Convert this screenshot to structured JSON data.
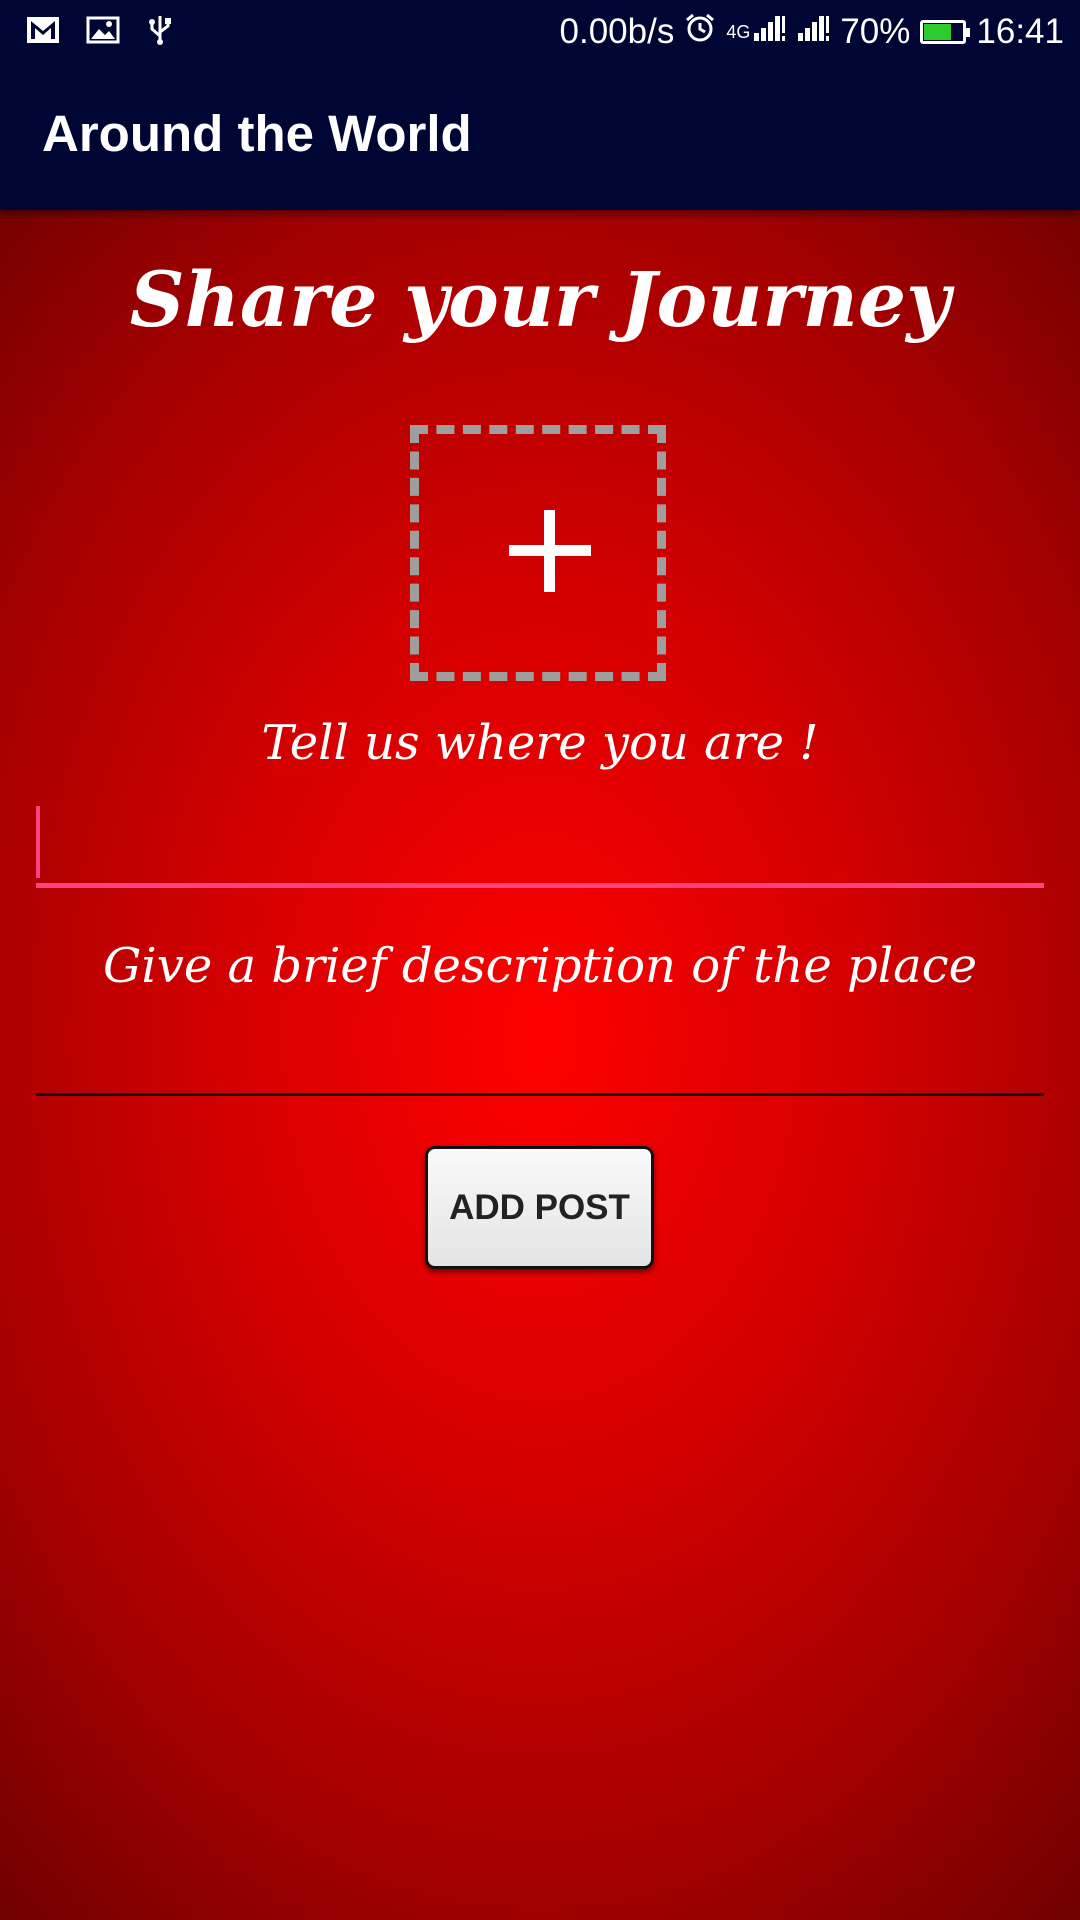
{
  "status_bar": {
    "network_speed": "0.00b/s",
    "network_type": "4G",
    "battery_percent": "70%",
    "battery_level": 0.7,
    "time": "16:41",
    "icons": [
      "gmail-icon",
      "image-icon",
      "usb-icon",
      "alarm-icon",
      "signal-icon",
      "signal-icon-2",
      "battery-icon"
    ]
  },
  "app_bar": {
    "title": "Around the World"
  },
  "form": {
    "heading": "Share your Journey",
    "add_image_icon": "plus-icon",
    "location_label": "Tell us where you are !",
    "location_value": "",
    "description_label": "Give a brief description of the place",
    "description_value": "",
    "submit_label": "ADD POST"
  },
  "colors": {
    "app_bar": "#000633",
    "accent": "#ff4081",
    "background_center": "#ff0000",
    "background_edge": "#6c0000",
    "battery": "#2ecc2e"
  }
}
